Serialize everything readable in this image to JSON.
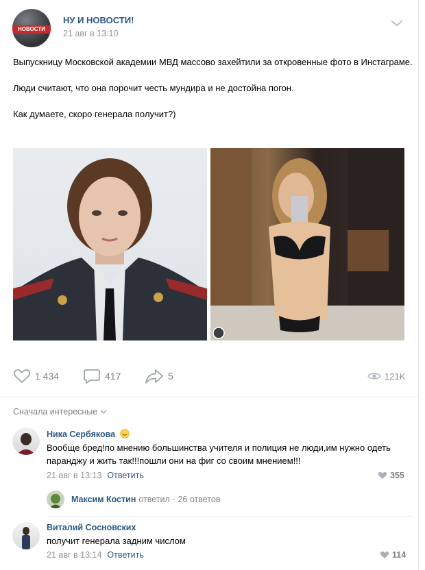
{
  "post": {
    "author": "НУ И НОВОСТИ!",
    "date": "21 авг в 13:10",
    "avatar_logo_text": "НОВОСТИ",
    "paragraphs": [
      "Выпускницу Московской академии МВД массово захейтили за откровенные фото в Инстаграме.",
      "Люди считают, что она порочит честь мундира и не достойна погон.",
      "Как думаете, скоро генерала получит?)"
    ],
    "likes": "1 434",
    "comments": "417",
    "shares": "5",
    "views": "121K"
  },
  "comments": {
    "sort_label": "Сначала интересные",
    "items": [
      {
        "name": "Ника Сербякова",
        "text": "Вообще бред!по мнению большинства учителя и полиция не люди,им нужно одеть паранджу и жить так!!!пошли они на фиг со своим мнением!!!",
        "date": "21 авг в 13:13",
        "reply_label": "Ответить",
        "likes": "355"
      },
      {
        "name": "Виталий Сосновских",
        "text": "получит генерала задним числом",
        "date": "21 авг в 13:14",
        "reply_label": "Ответить",
        "likes": "114"
      }
    ],
    "thread": {
      "name": "Максим Костин",
      "verb": "ответил",
      "count": "· 26 ответов"
    }
  },
  "colors": {
    "link": "#2a5885",
    "muted": "#939393",
    "icon": "#99a2ad"
  }
}
